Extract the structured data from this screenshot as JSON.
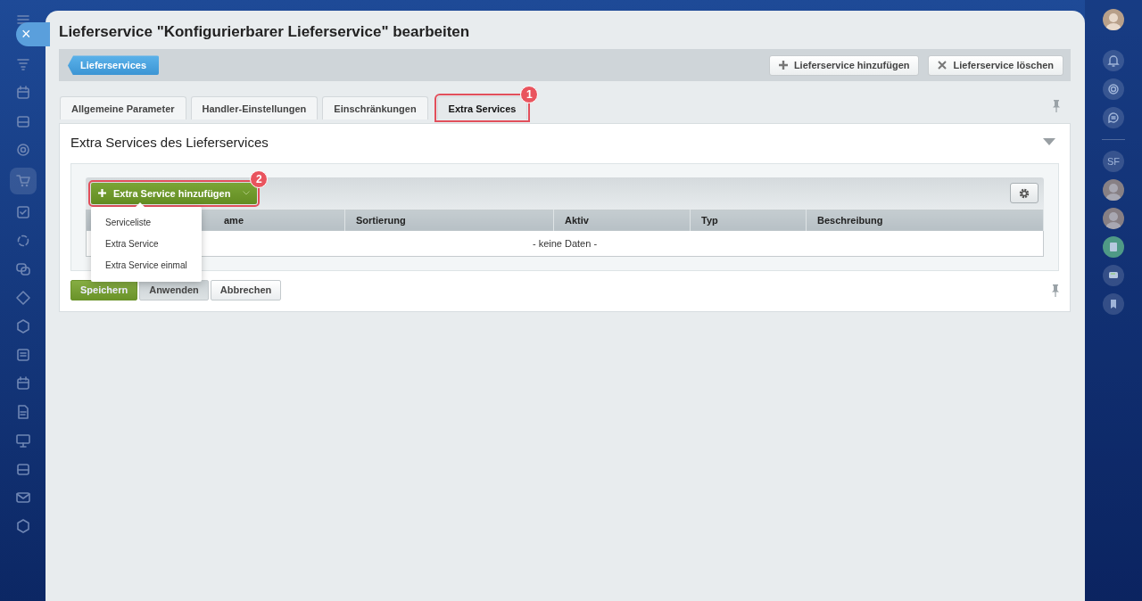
{
  "close_button": {
    "label": "×"
  },
  "left_rail": [
    {
      "kind": "menu",
      "selected": false
    },
    {
      "kind": "filter",
      "selected": false
    },
    {
      "kind": "calendar",
      "selected": false
    },
    {
      "kind": "drive",
      "selected": false
    },
    {
      "kind": "target",
      "selected": false
    },
    {
      "kind": "cart",
      "selected": true
    },
    {
      "kind": "check",
      "selected": false
    },
    {
      "kind": "cycle",
      "selected": false
    },
    {
      "kind": "chat",
      "selected": false
    },
    {
      "kind": "star",
      "selected": false
    },
    {
      "kind": "hexagon",
      "selected": false
    },
    {
      "kind": "list",
      "selected": false
    },
    {
      "kind": "calendar",
      "selected": false
    },
    {
      "kind": "document",
      "selected": false
    },
    {
      "kind": "board",
      "selected": false
    },
    {
      "kind": "drive",
      "selected": false
    },
    {
      "kind": "mail",
      "selected": false
    },
    {
      "kind": "hexagon",
      "selected": false
    }
  ],
  "window": {
    "title": "Lieferservice \"Konfigurierbarer Lieferservice\" bearbeiten"
  },
  "toolbar": {
    "back_button": "Lieferservices",
    "buttons": [
      {
        "kind": "add",
        "label": "Lieferservice hinzufügen"
      },
      {
        "kind": "delete",
        "label": "Lieferservice löschen"
      }
    ]
  },
  "tabs": [
    {
      "label": "Allgemeine Parameter",
      "selected": false
    },
    {
      "label": "Handler-Einstellungen",
      "selected": false
    },
    {
      "label": "Einschränkungen",
      "selected": false
    },
    {
      "label": "Extra Services",
      "selected": true,
      "callout": "1"
    }
  ],
  "section": {
    "title": "Extra Services des Lieferservices",
    "add_button": {
      "label": "Extra Service hinzufügen",
      "callout": "2"
    },
    "menu": [
      "Serviceliste",
      "Extra Service",
      "Extra Service einmal"
    ],
    "table": {
      "columns": [
        "ame",
        "Sortierung",
        "Aktiv",
        "Typ",
        "Beschreibung"
      ],
      "empty_text": "- keine Daten -"
    }
  },
  "footer_buttons": [
    {
      "kind": "primary",
      "label": "Speichern"
    },
    {
      "kind": "pressed",
      "label": "Anwenden"
    },
    {
      "kind": "plain",
      "label": "Abbrechen"
    }
  ],
  "right_rail": [
    {
      "kind": "avatar"
    },
    {
      "kind": "bell"
    },
    {
      "kind": "spiral"
    },
    {
      "kind": "chat"
    },
    {
      "kind": "divider"
    },
    {
      "kind": "initials",
      "text": "SF"
    },
    {
      "kind": "avatar"
    },
    {
      "kind": "avatar"
    },
    {
      "kind": "document"
    },
    {
      "kind": "message"
    },
    {
      "kind": "bookmark"
    }
  ]
}
